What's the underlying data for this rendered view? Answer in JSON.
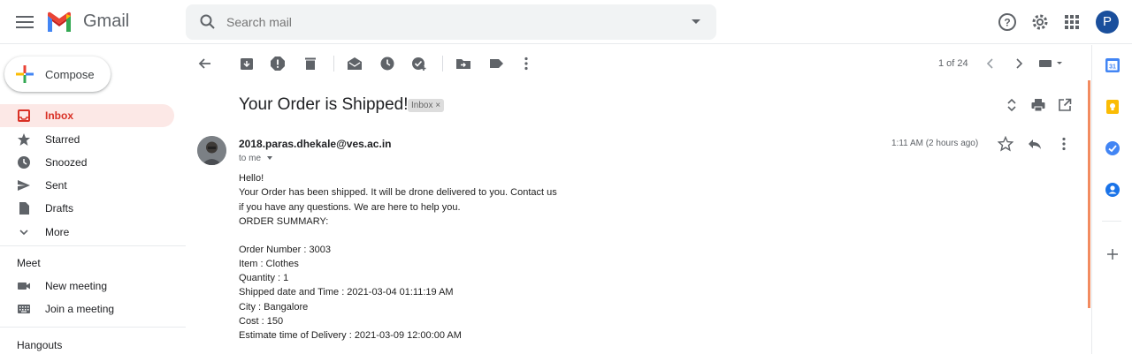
{
  "header": {
    "app_name": "Gmail",
    "search_placeholder": "Search mail",
    "avatar_letter": "P"
  },
  "sidebar": {
    "compose_label": "Compose",
    "items": [
      {
        "label": "Inbox",
        "icon": "inbox-icon",
        "active": true
      },
      {
        "label": "Starred",
        "icon": "star-icon"
      },
      {
        "label": "Snoozed",
        "icon": "clock-icon"
      },
      {
        "label": "Sent",
        "icon": "send-icon"
      },
      {
        "label": "Drafts",
        "icon": "draft-icon"
      },
      {
        "label": "More",
        "icon": "chevron-down-icon"
      }
    ],
    "meet_title": "Meet",
    "meet_items": [
      {
        "label": "New meeting",
        "icon": "video-icon"
      },
      {
        "label": "Join a meeting",
        "icon": "keyboard-icon"
      }
    ],
    "hangouts_title": "Hangouts"
  },
  "toolbar": {
    "pager": "1 of 24"
  },
  "email": {
    "subject": "Your Order is Shipped!",
    "label_chip": "Inbox ×",
    "sender": "2018.paras.dhekale@ves.ac.in",
    "to": "to me",
    "time": "1:11 AM (2 hours ago)",
    "body_lines": [
      "Hello!",
      "Your Order has been shipped. It will be drone delivered to you. Contact us",
      "if you have any questions. We are here to help you.",
      "ORDER SUMMARY:",
      "",
      "Order Number : 3003",
      "Item : Clothes",
      "Quantity : 1",
      "Shipped date and Time :  2021-03-04 01:11:19 AM",
      "City : Bangalore",
      "Cost : 150",
      "Estimate time of Delivery :  2021-03-09 12:00:00 AM"
    ]
  },
  "colors": {
    "accent_red": "#d93025",
    "active_bg": "#fce8e6",
    "avatar_blue": "#1a4f9c"
  }
}
